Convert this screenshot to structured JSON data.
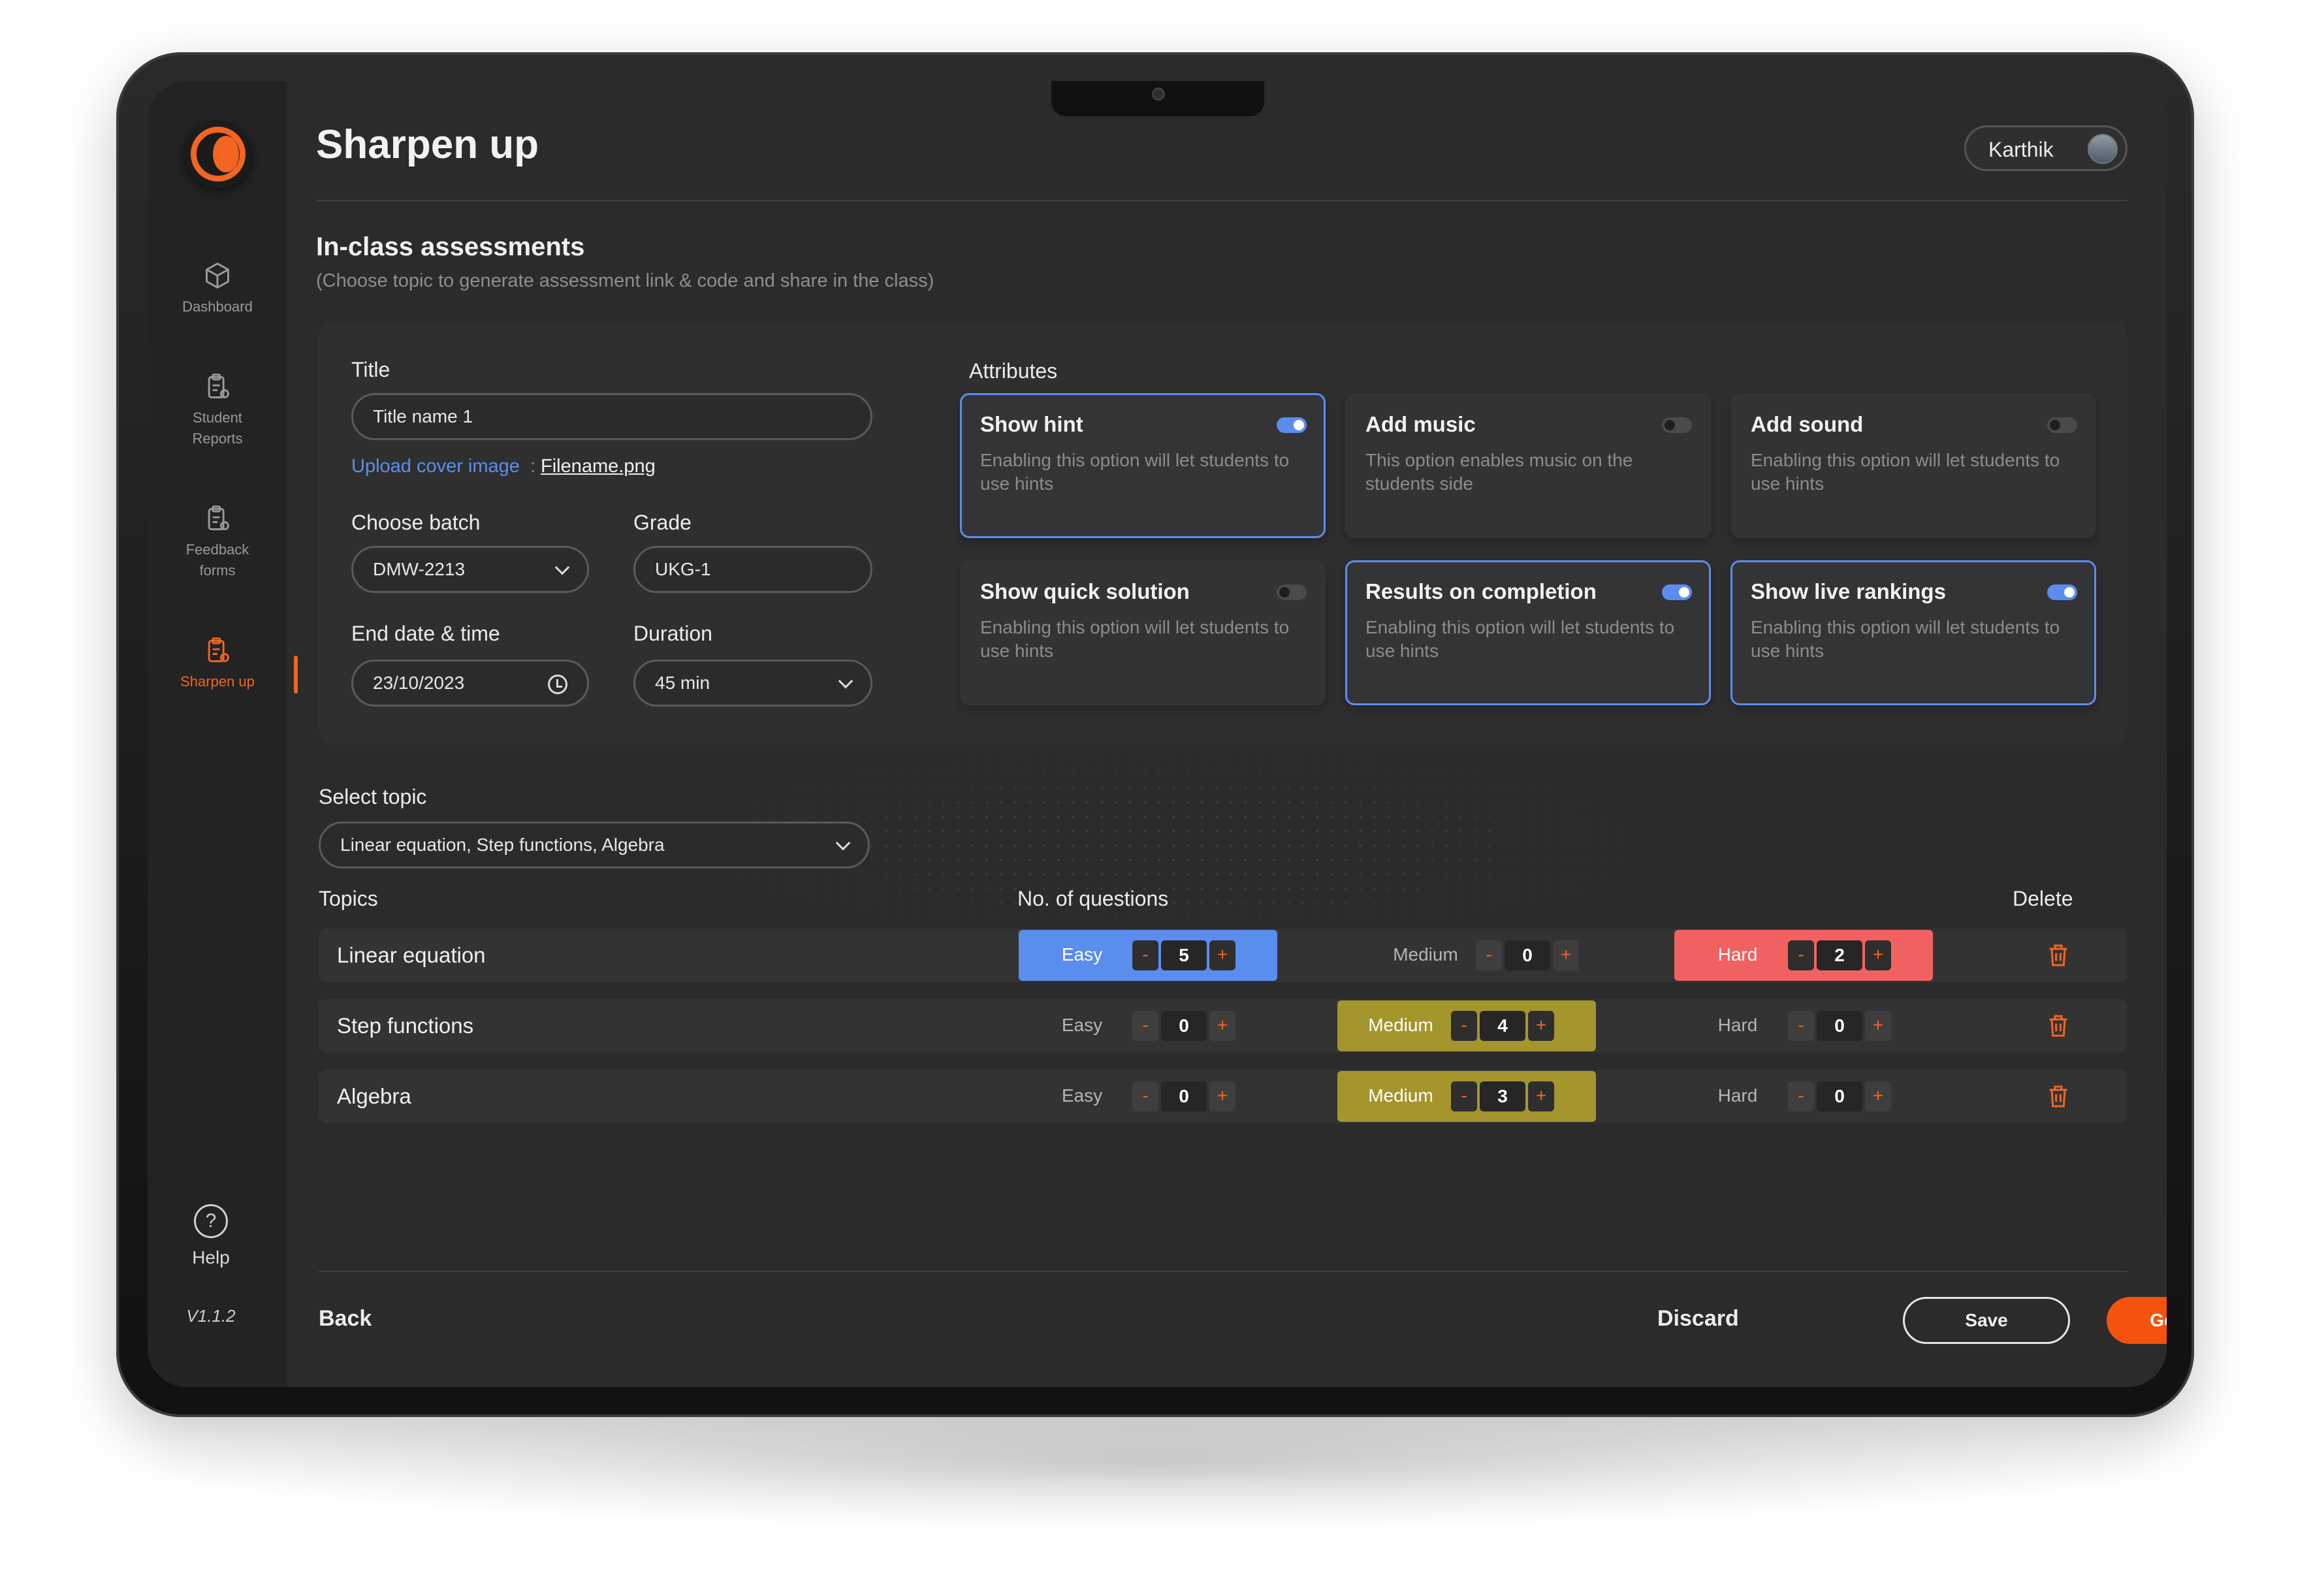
{
  "app": {
    "title": "Sharpen up",
    "user": "Karthik",
    "version": "V1.1.2"
  },
  "sidebar": {
    "items": [
      {
        "label": "Dashboard",
        "icon": "cube-icon"
      },
      {
        "label": "Student Reports",
        "icon": "clipboard-report-icon"
      },
      {
        "label": "Feedback forms",
        "icon": "clipboard-form-icon"
      },
      {
        "label": "Sharpen up",
        "icon": "clipboard-sharpen-icon",
        "active": true
      }
    ],
    "help": "Help",
    "help_glyph": "?"
  },
  "section": {
    "title": "In-class assessments",
    "subtitle": "(Choose topic to generate assessment link & code and share in the class)"
  },
  "form": {
    "title_label": "Title",
    "title_value": "Title name 1",
    "upload_label": "Upload cover image",
    "upload_sep": ":",
    "filename": "Filename.png",
    "batch_label": "Choose batch",
    "batch_value": "DMW-2213",
    "grade_label": "Grade",
    "grade_value": "UKG-1",
    "end_label": "End date & time",
    "end_value": "23/10/2023",
    "duration_label": "Duration",
    "duration_value": "45 min"
  },
  "attributes": {
    "label": "Attributes",
    "items": [
      {
        "title": "Show hint",
        "desc": "Enabling this option will let students to use hints",
        "on": true
      },
      {
        "title": "Add music",
        "desc": "This option enables music on the students side",
        "on": false
      },
      {
        "title": "Add sound",
        "desc": "Enabling this option will let students to use hints",
        "on": false
      },
      {
        "title": "Show quick solution",
        "desc": "Enabling this option will let students to use hints",
        "on": false
      },
      {
        "title": "Results on completion",
        "desc": "Enabling this option will let students to use hints",
        "on": true
      },
      {
        "title": "Show live rankings",
        "desc": "Enabling this option will let students to use hints",
        "on": true
      }
    ]
  },
  "topic_select": {
    "label": "Select topic",
    "value": "Linear equation, Step functions, Algebra"
  },
  "table": {
    "col_topics": "Topics",
    "col_questions": "No. of questions",
    "col_delete": "Delete",
    "difficulty_labels": [
      "Easy",
      "Medium",
      "Hard"
    ],
    "stepper_minus": "-",
    "stepper_plus": "+",
    "rows": [
      {
        "topic": "Linear equation",
        "easy": "5",
        "medium": "0",
        "hard": "2",
        "highlight": [
          "easy",
          "hard"
        ]
      },
      {
        "topic": "Step functions",
        "easy": "0",
        "medium": "4",
        "hard": "0",
        "highlight": [
          "medium"
        ]
      },
      {
        "topic": "Algebra",
        "easy": "0",
        "medium": "3",
        "hard": "0",
        "highlight": [
          "medium"
        ]
      }
    ]
  },
  "footer": {
    "back": "Back",
    "discard": "Discard",
    "save": "Save",
    "generate": "Generate"
  },
  "colors": {
    "accent": "#f26522",
    "easy": "#5b8def",
    "medium": "#a5952d",
    "hard": "#f26161",
    "generate": "#f4520d"
  }
}
